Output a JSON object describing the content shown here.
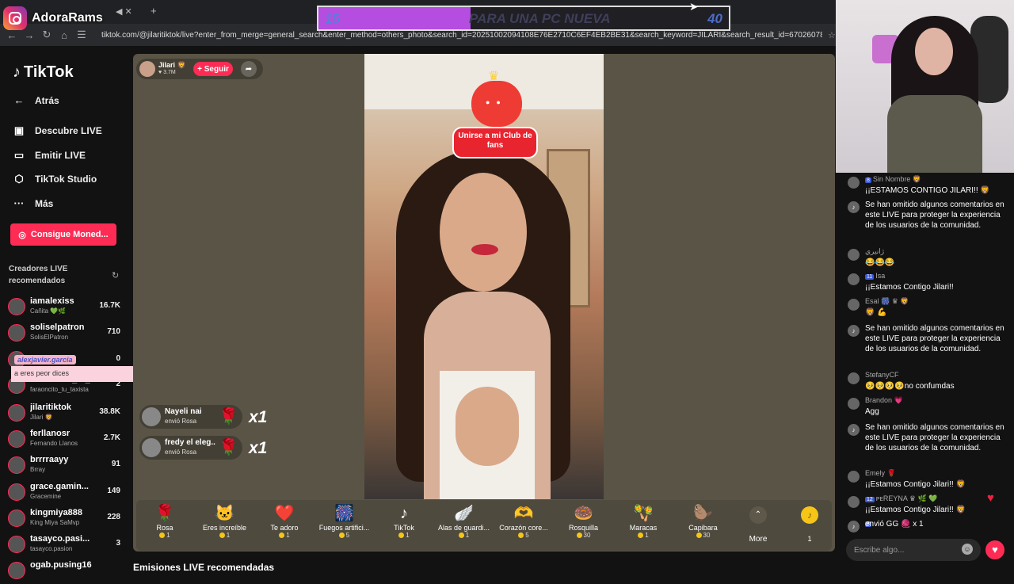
{
  "browser": {
    "tab_icons": "◀ ✕",
    "new_tab": "+",
    "url": "tiktok.com/@jilaritiktok/live?enter_from_merge=general_search&enter_method=others_photo&search_id=2025100209410​8E76E2710C6EF4EB2BE31&search_keyword=JILARI&search_result_id=670260786587148391​0&s..."
  },
  "brand": {
    "name": "AdoraRams"
  },
  "goal": {
    "start": "15",
    "title": "PARA UNA PC NUEVA",
    "end": "40",
    "progress": 0.37,
    "fill_color": "#b44de0"
  },
  "sidebar": {
    "logo": "TikTok",
    "items": [
      {
        "label": "Atrás",
        "icon": "back-arrow-icon"
      },
      {
        "label": "Descubre LIVE",
        "icon": "live-icon"
      },
      {
        "label": "Emitir LIVE",
        "icon": "camera-icon"
      },
      {
        "label": "TikTok Studio",
        "icon": "studio-icon"
      },
      {
        "label": "Más",
        "icon": "more-icon"
      }
    ],
    "coins_button": "Consigue Moned...",
    "reco_title": "Creadores LIVE recomendados",
    "creators": [
      {
        "name": "iamalexiss",
        "sub": "Cañita 💚🌿",
        "views": "16.7K"
      },
      {
        "name": "soliselpatron",
        "sub": "SolisElPatron",
        "views": "710"
      },
      {
        "name": "",
        "sub": "",
        "views": "0"
      },
      {
        "name": "faraoncito_tu_...",
        "sub": "faraoncito_tu_taxista",
        "views": "2"
      },
      {
        "name": "jilaritiktok",
        "sub": "Jilari 🦁",
        "views": "38.8K"
      },
      {
        "name": "ferllanosr",
        "sub": "Fernando Llanos",
        "views": "2.7K"
      },
      {
        "name": "brrrraayy",
        "sub": "Brray",
        "views": "91"
      },
      {
        "name": "grace.gamin...",
        "sub": "Gracemine",
        "views": "149"
      },
      {
        "name": "kingmiya888",
        "sub": "King Miya SaMvp",
        "views": "228"
      },
      {
        "name": "tasayco.pasi...",
        "sub": "tasayco.pasion",
        "views": "3"
      },
      {
        "name": "ogab.pusing16",
        "sub": "",
        "views": ""
      }
    ],
    "alert_user": "alexjavier.garcia",
    "alert_msg": "a eres peor dices"
  },
  "stream": {
    "host_name": "Jilari 🦁",
    "host_likes": "♥ 3.7M",
    "follow_label": "+ Seguir",
    "club_label": "Unirse a mi Club de fans",
    "gift_notes": [
      {
        "name": "Nayeli nai",
        "sub": "envió Rosa",
        "mult": "x1"
      },
      {
        "name": "fredy el eleg...",
        "sub": "envió Rosa",
        "mult": "x1"
      }
    ]
  },
  "gifts": [
    {
      "name": "Rosa",
      "price": "1",
      "icon": "🌹"
    },
    {
      "name": "Eres increíble",
      "price": "1",
      "icon": "🐱"
    },
    {
      "name": "Te adoro",
      "price": "1",
      "icon": "❤️"
    },
    {
      "name": "Fuegos artifici...",
      "price": "5",
      "icon": "🎆"
    },
    {
      "name": "TikTok",
      "price": "1",
      "icon": "♪"
    },
    {
      "name": "Alas de guardi...",
      "price": "1",
      "icon": "🪽"
    },
    {
      "name": "Corazón core...",
      "price": "5",
      "icon": "🫶"
    },
    {
      "name": "Rosquilla",
      "price": "30",
      "icon": "🍩"
    },
    {
      "name": "Maracas",
      "price": "1",
      "icon": "🪇"
    },
    {
      "name": "Capibara",
      "price": "30",
      "icon": "🦫"
    }
  ],
  "more_label": "More",
  "coin_count": "1",
  "recommended_section": "Emisiones LIVE recomendadas",
  "chat": {
    "messages": [
      {
        "user": "Sin Nombre 🦁",
        "badge": "8",
        "text": "¡¡ESTAMOS CONTIGO JILARI!! 🦁"
      },
      {
        "user": "",
        "badge": "",
        "text": "Se han omitido algunos comentarios en este LIVE para proteger la experiencia de los usuarios de la comunidad."
      },
      {
        "user": "ژانیري",
        "badge": "",
        "text": "😂😂😂"
      },
      {
        "user": "Isa",
        "badge": "11",
        "text": "¡¡Estamos Contigo Jilari!!"
      },
      {
        "user": "Esal 🎆 ♛ 🦁",
        "badge": "",
        "text": "🦁 💪"
      },
      {
        "user": "",
        "badge": "",
        "text": "Se han omitido algunos comentarios en este LIVE para proteger la experiencia de los usuarios de la comunidad."
      },
      {
        "user": "StefanyCF",
        "badge": "",
        "text": "🥺🥺🥺🥺no confumdas"
      },
      {
        "user": "Brandon 💗",
        "badge": "",
        "text": "Agg"
      },
      {
        "user": "",
        "badge": "",
        "text": "Se han omitido algunos comentarios en este LIVE para proteger la experiencia de los usuarios de la comunidad."
      },
      {
        "user": "Emely 🌹",
        "badge": "",
        "text": "¡¡Estamos Contigo Jilari!! 🦁"
      },
      {
        "user": "ᴘᴇREYNA ♛ 🌿 💚",
        "badge": "12",
        "text": "¡¡Estamos Contigo Jilari!! 🦁"
      },
      {
        "user": "",
        "badge": "8",
        "text": "envió GG 🧶 x 1"
      }
    ],
    "input_placeholder": "Escribe algo..."
  }
}
